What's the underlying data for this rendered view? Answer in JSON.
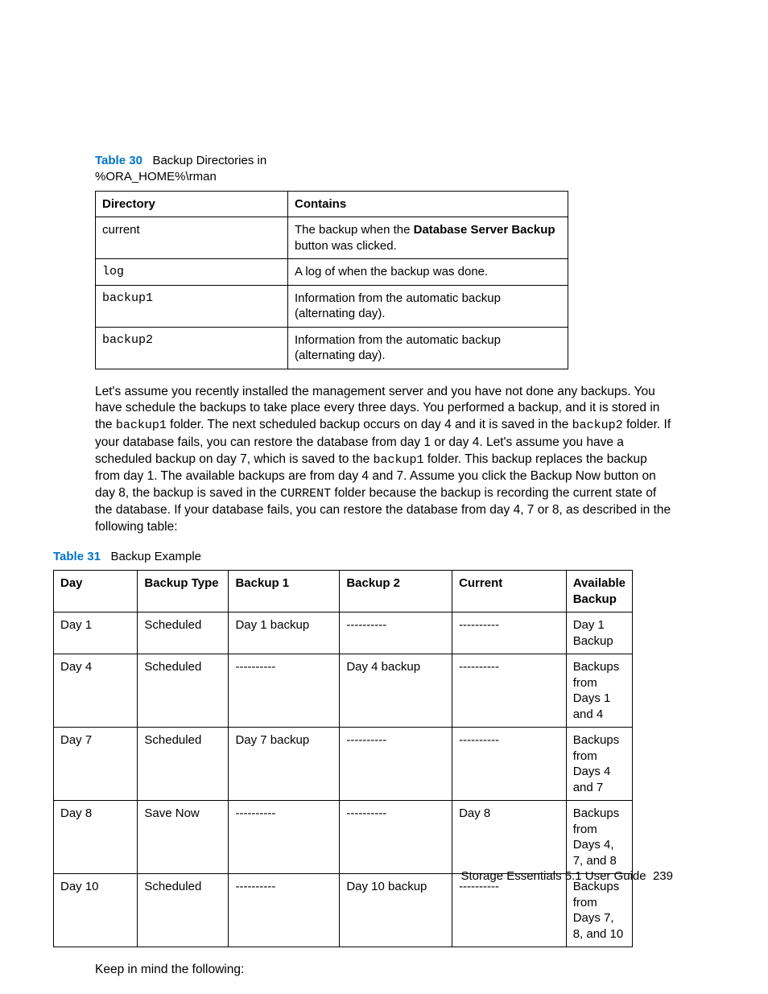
{
  "table30": {
    "label": "Table 30",
    "title_part1": "Backup Directories in",
    "title_part2": "%ORA_HOME%\\rman",
    "headers": [
      "Directory",
      "Contains"
    ],
    "rows": [
      {
        "dir": "current",
        "contains_pre": "The backup when the ",
        "contains_bold": "Database Server Backup",
        "contains_post": " button was clicked."
      },
      {
        "dir": "log",
        "contains_pre": "A log of when the backup was done.",
        "contains_bold": "",
        "contains_post": ""
      },
      {
        "dir": "backup1",
        "contains_pre": "Information from the automatic backup (alternating day).",
        "contains_bold": "",
        "contains_post": ""
      },
      {
        "dir": "backup2",
        "contains_pre": "Information from the automatic backup (alternating day).",
        "contains_bold": "",
        "contains_post": ""
      }
    ]
  },
  "paragraph": {
    "p1": "Let's assume you recently installed the management server and you have not done any backups. You have schedule the backups to take place every three days. You performed a backup, and it is stored in the ",
    "c1": "backup1",
    "p2": " folder. The next scheduled backup occurs on day 4 and it is saved in the ",
    "c2": "backup2",
    "p3": " folder. If your database fails, you can restore the database from day 1 or day 4. Let's assume you have a scheduled backup on day 7, which is saved to the ",
    "c3": "backup1",
    "p4": " folder. This backup replaces the backup from day 1. The available backups are from day 4 and 7. Assume you click the ",
    "b1": "Backup Now",
    "p5": " button on day 8, the backup is saved in the ",
    "c4": "CURRENT",
    "p6": " folder because the backup is recording the current state of the database. If your database fails, you can restore the database from day 4, 7 or 8, as described in the following table:"
  },
  "table31": {
    "label": "Table 31",
    "title": "Backup Example",
    "headers": [
      "Day",
      "Backup Type",
      "Backup 1",
      "Backup 2",
      "Current",
      "Available Backup"
    ],
    "rows": [
      [
        "Day 1",
        "Scheduled",
        "Day 1 backup",
        "----------",
        "----------",
        "Day 1 Backup"
      ],
      [
        "Day 4",
        "Scheduled",
        "----------",
        "Day 4 backup",
        "----------",
        "Backups from Days 1 and 4"
      ],
      [
        "Day 7",
        "Scheduled",
        "Day 7 backup",
        "----------",
        "----------",
        "Backups from Days 4 and 7"
      ],
      [
        "Day 8",
        "Save Now",
        "----------",
        "----------",
        "Day 8",
        "Backups from Days 4, 7, and 8"
      ],
      [
        "Day 10",
        "Scheduled",
        "----------",
        "Day 10 backup",
        "----------",
        "Backups from Days 7, 8, and 10"
      ]
    ]
  },
  "closing": "Keep in mind the following:",
  "footer": {
    "text": "Storage Essentials 5.1 User Guide",
    "page": "239"
  }
}
